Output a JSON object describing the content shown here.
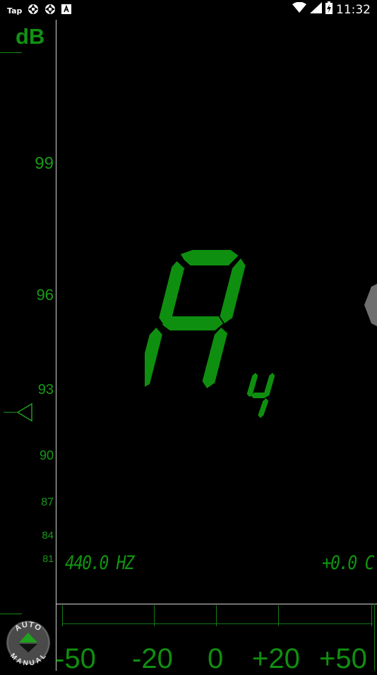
{
  "status_bar": {
    "app_label": "Tap",
    "time": "11:32"
  },
  "db_meter": {
    "title": "dB",
    "ticks": [
      "99",
      "96",
      "93",
      "90",
      "87",
      "84",
      "81"
    ]
  },
  "note": {
    "name": "A",
    "octave": "4"
  },
  "readouts": {
    "frequency": "440.0 HZ",
    "cents": "+0.0 C"
  },
  "cents_scale": {
    "labels": [
      "-50",
      "-20",
      "0",
      "+20",
      "+50"
    ]
  },
  "mode_toggle": {
    "top_label": "AUTO",
    "bottom_label": "MANUAL"
  },
  "colors": {
    "accent": "#129212",
    "background": "#000000"
  }
}
